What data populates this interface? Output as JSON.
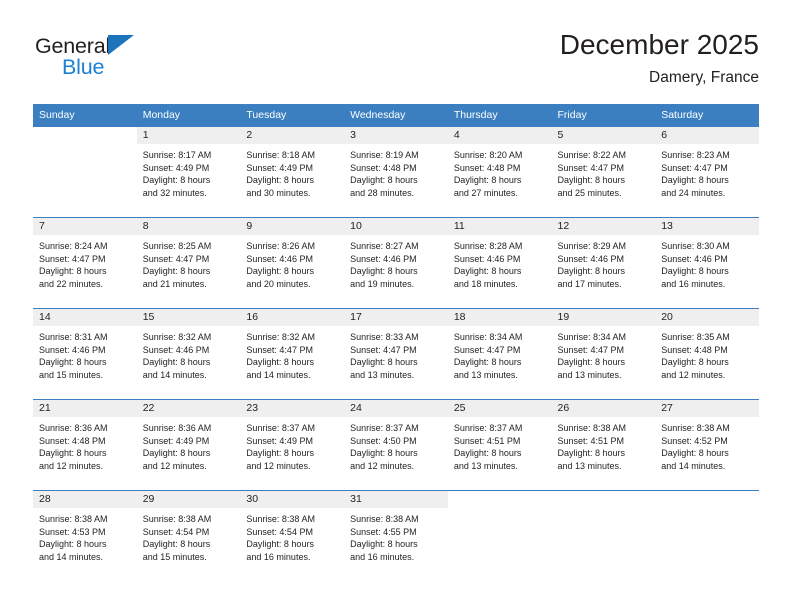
{
  "brand": {
    "name_top": "General",
    "name_bottom": "Blue",
    "accent_color": "#1c81d4",
    "triangle_color": "#1c75bc"
  },
  "header": {
    "title": "December 2025",
    "subtitle": "Damery, France"
  },
  "theme": {
    "header_row_bg": "#3c7fc0",
    "daynum_bg": "#efefef",
    "text_color": "#231f20"
  },
  "weekday_headers": [
    "Sunday",
    "Monday",
    "Tuesday",
    "Wednesday",
    "Thursday",
    "Friday",
    "Saturday"
  ],
  "weeks": [
    [
      {
        "day": "",
        "sunrise": "",
        "sunset": "",
        "daylight_1": "",
        "daylight_2": "",
        "blank": true
      },
      {
        "day": "1",
        "sunrise": "Sunrise: 8:17 AM",
        "sunset": "Sunset: 4:49 PM",
        "daylight_1": "Daylight: 8 hours",
        "daylight_2": "and 32 minutes."
      },
      {
        "day": "2",
        "sunrise": "Sunrise: 8:18 AM",
        "sunset": "Sunset: 4:49 PM",
        "daylight_1": "Daylight: 8 hours",
        "daylight_2": "and 30 minutes."
      },
      {
        "day": "3",
        "sunrise": "Sunrise: 8:19 AM",
        "sunset": "Sunset: 4:48 PM",
        "daylight_1": "Daylight: 8 hours",
        "daylight_2": "and 28 minutes."
      },
      {
        "day": "4",
        "sunrise": "Sunrise: 8:20 AM",
        "sunset": "Sunset: 4:48 PM",
        "daylight_1": "Daylight: 8 hours",
        "daylight_2": "and 27 minutes."
      },
      {
        "day": "5",
        "sunrise": "Sunrise: 8:22 AM",
        "sunset": "Sunset: 4:47 PM",
        "daylight_1": "Daylight: 8 hours",
        "daylight_2": "and 25 minutes."
      },
      {
        "day": "6",
        "sunrise": "Sunrise: 8:23 AM",
        "sunset": "Sunset: 4:47 PM",
        "daylight_1": "Daylight: 8 hours",
        "daylight_2": "and 24 minutes."
      }
    ],
    [
      {
        "day": "7",
        "sunrise": "Sunrise: 8:24 AM",
        "sunset": "Sunset: 4:47 PM",
        "daylight_1": "Daylight: 8 hours",
        "daylight_2": "and 22 minutes."
      },
      {
        "day": "8",
        "sunrise": "Sunrise: 8:25 AM",
        "sunset": "Sunset: 4:47 PM",
        "daylight_1": "Daylight: 8 hours",
        "daylight_2": "and 21 minutes."
      },
      {
        "day": "9",
        "sunrise": "Sunrise: 8:26 AM",
        "sunset": "Sunset: 4:46 PM",
        "daylight_1": "Daylight: 8 hours",
        "daylight_2": "and 20 minutes."
      },
      {
        "day": "10",
        "sunrise": "Sunrise: 8:27 AM",
        "sunset": "Sunset: 4:46 PM",
        "daylight_1": "Daylight: 8 hours",
        "daylight_2": "and 19 minutes."
      },
      {
        "day": "11",
        "sunrise": "Sunrise: 8:28 AM",
        "sunset": "Sunset: 4:46 PM",
        "daylight_1": "Daylight: 8 hours",
        "daylight_2": "and 18 minutes."
      },
      {
        "day": "12",
        "sunrise": "Sunrise: 8:29 AM",
        "sunset": "Sunset: 4:46 PM",
        "daylight_1": "Daylight: 8 hours",
        "daylight_2": "and 17 minutes."
      },
      {
        "day": "13",
        "sunrise": "Sunrise: 8:30 AM",
        "sunset": "Sunset: 4:46 PM",
        "daylight_1": "Daylight: 8 hours",
        "daylight_2": "and 16 minutes."
      }
    ],
    [
      {
        "day": "14",
        "sunrise": "Sunrise: 8:31 AM",
        "sunset": "Sunset: 4:46 PM",
        "daylight_1": "Daylight: 8 hours",
        "daylight_2": "and 15 minutes."
      },
      {
        "day": "15",
        "sunrise": "Sunrise: 8:32 AM",
        "sunset": "Sunset: 4:46 PM",
        "daylight_1": "Daylight: 8 hours",
        "daylight_2": "and 14 minutes."
      },
      {
        "day": "16",
        "sunrise": "Sunrise: 8:32 AM",
        "sunset": "Sunset: 4:47 PM",
        "daylight_1": "Daylight: 8 hours",
        "daylight_2": "and 14 minutes."
      },
      {
        "day": "17",
        "sunrise": "Sunrise: 8:33 AM",
        "sunset": "Sunset: 4:47 PM",
        "daylight_1": "Daylight: 8 hours",
        "daylight_2": "and 13 minutes."
      },
      {
        "day": "18",
        "sunrise": "Sunrise: 8:34 AM",
        "sunset": "Sunset: 4:47 PM",
        "daylight_1": "Daylight: 8 hours",
        "daylight_2": "and 13 minutes."
      },
      {
        "day": "19",
        "sunrise": "Sunrise: 8:34 AM",
        "sunset": "Sunset: 4:47 PM",
        "daylight_1": "Daylight: 8 hours",
        "daylight_2": "and 13 minutes."
      },
      {
        "day": "20",
        "sunrise": "Sunrise: 8:35 AM",
        "sunset": "Sunset: 4:48 PM",
        "daylight_1": "Daylight: 8 hours",
        "daylight_2": "and 12 minutes."
      }
    ],
    [
      {
        "day": "21",
        "sunrise": "Sunrise: 8:36 AM",
        "sunset": "Sunset: 4:48 PM",
        "daylight_1": "Daylight: 8 hours",
        "daylight_2": "and 12 minutes."
      },
      {
        "day": "22",
        "sunrise": "Sunrise: 8:36 AM",
        "sunset": "Sunset: 4:49 PM",
        "daylight_1": "Daylight: 8 hours",
        "daylight_2": "and 12 minutes."
      },
      {
        "day": "23",
        "sunrise": "Sunrise: 8:37 AM",
        "sunset": "Sunset: 4:49 PM",
        "daylight_1": "Daylight: 8 hours",
        "daylight_2": "and 12 minutes."
      },
      {
        "day": "24",
        "sunrise": "Sunrise: 8:37 AM",
        "sunset": "Sunset: 4:50 PM",
        "daylight_1": "Daylight: 8 hours",
        "daylight_2": "and 12 minutes."
      },
      {
        "day": "25",
        "sunrise": "Sunrise: 8:37 AM",
        "sunset": "Sunset: 4:51 PM",
        "daylight_1": "Daylight: 8 hours",
        "daylight_2": "and 13 minutes."
      },
      {
        "day": "26",
        "sunrise": "Sunrise: 8:38 AM",
        "sunset": "Sunset: 4:51 PM",
        "daylight_1": "Daylight: 8 hours",
        "daylight_2": "and 13 minutes."
      },
      {
        "day": "27",
        "sunrise": "Sunrise: 8:38 AM",
        "sunset": "Sunset: 4:52 PM",
        "daylight_1": "Daylight: 8 hours",
        "daylight_2": "and 14 minutes."
      }
    ],
    [
      {
        "day": "28",
        "sunrise": "Sunrise: 8:38 AM",
        "sunset": "Sunset: 4:53 PM",
        "daylight_1": "Daylight: 8 hours",
        "daylight_2": "and 14 minutes."
      },
      {
        "day": "29",
        "sunrise": "Sunrise: 8:38 AM",
        "sunset": "Sunset: 4:54 PM",
        "daylight_1": "Daylight: 8 hours",
        "daylight_2": "and 15 minutes."
      },
      {
        "day": "30",
        "sunrise": "Sunrise: 8:38 AM",
        "sunset": "Sunset: 4:54 PM",
        "daylight_1": "Daylight: 8 hours",
        "daylight_2": "and 16 minutes."
      },
      {
        "day": "31",
        "sunrise": "Sunrise: 8:38 AM",
        "sunset": "Sunset: 4:55 PM",
        "daylight_1": "Daylight: 8 hours",
        "daylight_2": "and 16 minutes."
      },
      {
        "day": "",
        "sunrise": "",
        "sunset": "",
        "daylight_1": "",
        "daylight_2": "",
        "blank": true
      },
      {
        "day": "",
        "sunrise": "",
        "sunset": "",
        "daylight_1": "",
        "daylight_2": "",
        "blank": true
      },
      {
        "day": "",
        "sunrise": "",
        "sunset": "",
        "daylight_1": "",
        "daylight_2": "",
        "blank": true
      }
    ]
  ]
}
